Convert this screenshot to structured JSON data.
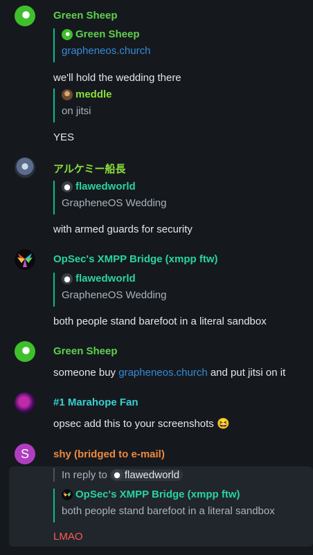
{
  "colors": {
    "background": "#15191e",
    "green_sheep": "#5fd14a",
    "alchemist": "#8cdf3a",
    "teal": "#29d4a0",
    "marahope": "#3ad0cf",
    "shy": "#f0883e",
    "lmao": "#ff5b55",
    "link": "#368bd6"
  },
  "messages": [
    {
      "sender": "Green Sheep",
      "quote": {
        "name": "Green Sheep",
        "text": "grapheneos.church"
      },
      "text": "we'll hold the wedding there",
      "quote2": {
        "name": "meddle",
        "text": "on jitsi"
      },
      "text2": "YES"
    },
    {
      "sender": "アルケミー船長",
      "quote": {
        "name": "flawedworld",
        "text": "GrapheneOS Wedding"
      },
      "text": "with armed guards for security"
    },
    {
      "sender": "OpSec's XMPP Bridge (xmpp ftw)",
      "quote": {
        "name": "flawedworld",
        "text": "GrapheneOS Wedding"
      },
      "text": "both people stand barefoot in a literal sandbox"
    },
    {
      "sender": "Green Sheep",
      "text_before": "someone buy ",
      "link": "grapheneos.church",
      "text_after": " and put jitsi on it"
    },
    {
      "sender": "#1 Marahope Fan",
      "text": "opsec add this to your screenshots",
      "emoji": "😆"
    },
    {
      "sender": "shy (bridged to e-mail)",
      "avatar_letter": "S",
      "reply_prefix": "In reply to",
      "reply_user": "flawedworld",
      "quote": {
        "name": "OpSec's XMPP Bridge (xmpp ftw)",
        "text": "both people stand barefoot in a literal sandbox"
      },
      "text": "LMAO"
    }
  ]
}
